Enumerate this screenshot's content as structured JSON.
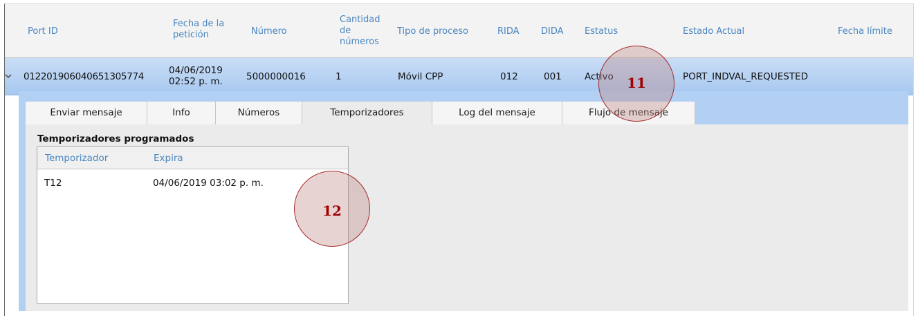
{
  "table": {
    "columns": {
      "port_id": "Port ID",
      "fecha_1": "Fecha de la",
      "fecha_2": "petición",
      "numero": "Número",
      "cantidad_1": "Cantidad",
      "cantidad_2": "de",
      "cantidad_3": "números",
      "tipo": "Tipo de proceso",
      "rida": "RIDA",
      "dida": "DIDA",
      "estatus": "Estatus",
      "estado": "Estado Actual",
      "fecha_limite": "Fecha límite"
    },
    "row": {
      "port_id": "0122019060406513057​74",
      "fecha_1": "04/06/2019",
      "fecha_2": "02:52 p. m.",
      "numero": "5000000016",
      "cantidad": "1",
      "tipo": "Móvil CPP",
      "rida": "012",
      "dida": "001",
      "estatus": "Activo",
      "estado": "PORT_INDVAL_REQUESTED"
    }
  },
  "tabs": [
    "Enviar mensaje",
    "Info",
    "Números",
    "Temporizadores",
    "Log del mensaje",
    "Flujo de mensaje"
  ],
  "active_tab": "Temporizadores",
  "timers": {
    "title": "Temporizadores programados",
    "col_timer": "Temporizador",
    "col_expires": "Expira",
    "rows": [
      {
        "timer": "T12",
        "expires": "04/06/2019 03:02 p. m."
      }
    ]
  },
  "callouts": [
    "11",
    "12"
  ],
  "colors": {
    "header_text": "#4a86c0",
    "row_highlight": "#b2d0f3",
    "callout": "#a00000"
  }
}
